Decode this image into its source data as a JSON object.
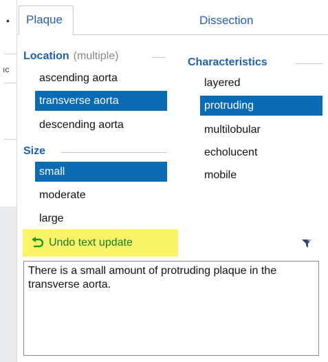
{
  "tabs": [
    {
      "label": "Plaque",
      "active": true
    },
    {
      "label": "Dissection",
      "active": false
    }
  ],
  "location": {
    "title": "Location",
    "qualifier": "(multiple)",
    "options": [
      {
        "label": "ascending aorta",
        "selected": false
      },
      {
        "label": "transverse aorta",
        "selected": true
      },
      {
        "label": "descending aorta",
        "selected": false
      }
    ]
  },
  "size": {
    "title": "Size",
    "options": [
      {
        "label": "small",
        "selected": true
      },
      {
        "label": "moderate",
        "selected": false
      },
      {
        "label": "large",
        "selected": false
      }
    ]
  },
  "characteristics": {
    "title": "Characteristics",
    "options": [
      {
        "label": "layered",
        "selected": false
      },
      {
        "label": "protruding",
        "selected": true
      },
      {
        "label": "multilobular",
        "selected": false
      },
      {
        "label": "echolucent",
        "selected": false
      },
      {
        "label": "mobile",
        "selected": false
      }
    ]
  },
  "undo": {
    "label": "Undo text update",
    "icon": "undo-icon"
  },
  "filter": {
    "icon": "filter-icon"
  },
  "report_text": "There is a small amount of protruding plaque in the transverse aorta.",
  "colors": {
    "accent": "#1f5fb3",
    "selected_bg": "#0a6bb5",
    "undo_bg": "#fbf46b",
    "undo_text": "#1a7a1a"
  }
}
